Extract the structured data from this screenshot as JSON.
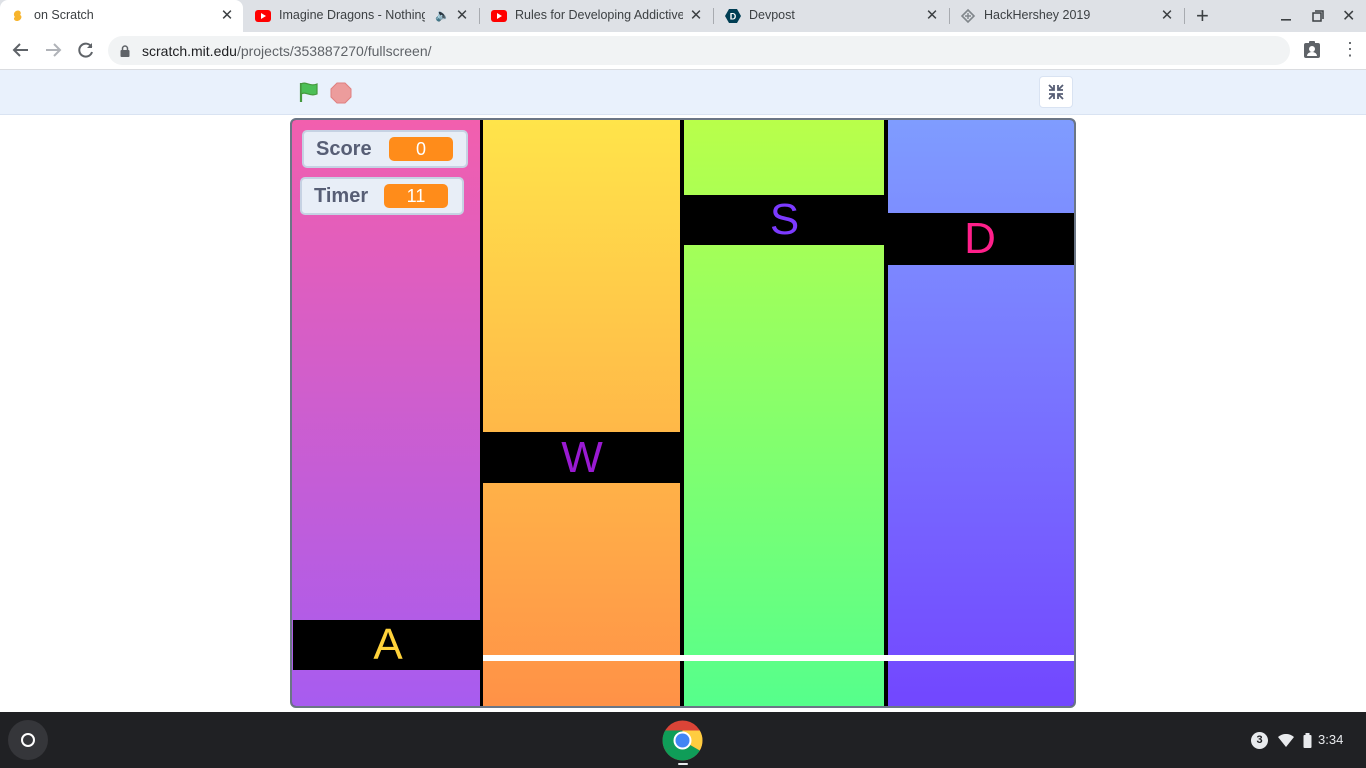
{
  "browser": {
    "tabs": [
      {
        "title": "on Scratch",
        "favicon": "scratch-icon",
        "active": true
      },
      {
        "title": "Imagine Dragons - Nothing",
        "favicon": "youtube-icon",
        "audio": true
      },
      {
        "title": "Rules for Developing Addictive M",
        "favicon": "youtube-icon"
      },
      {
        "title": "Devpost",
        "favicon": "devpost-icon"
      },
      {
        "title": "HackHershey 2019",
        "favicon": "hackhershey-icon"
      }
    ],
    "new_tab_icon": "plus-icon",
    "window_controls": [
      "minimize-icon",
      "restore-icon",
      "close-icon"
    ],
    "address": {
      "host": "scratch.mit.edu",
      "path": "/projects/353887270/fullscreen/"
    }
  },
  "player": {
    "green_flag_icon": "green-flag-icon",
    "stop_icon": "stop-icon",
    "exit_fullscreen_icon": "exit-fullscreen-icon"
  },
  "stage": {
    "monitors": [
      {
        "label": "Score",
        "value": "0"
      },
      {
        "label": "Timer",
        "value": "11"
      }
    ],
    "lanes": [
      {
        "key": "A",
        "key_color": "#ffd23a",
        "gradient": [
          "#f25fae",
          "#a75cf0"
        ]
      },
      {
        "key": "W",
        "key_color": "#9a1ad2",
        "gradient": [
          "#ffe44a",
          "#ff9147"
        ]
      },
      {
        "key": "S",
        "key_color": "#7c3aff",
        "gradient": [
          "#b9ff4a",
          "#55ff8c"
        ]
      },
      {
        "key": "D",
        "key_color": "#ff1f8a",
        "gradient": [
          "#7f9cff",
          "#7246ff"
        ]
      }
    ]
  },
  "taskbar": {
    "launcher_icon": "launcher-icon",
    "pinned_app": "chrome-icon",
    "notification_count": "3",
    "time": "3:34",
    "status_icons": [
      "wifi-icon",
      "battery-icon"
    ]
  }
}
